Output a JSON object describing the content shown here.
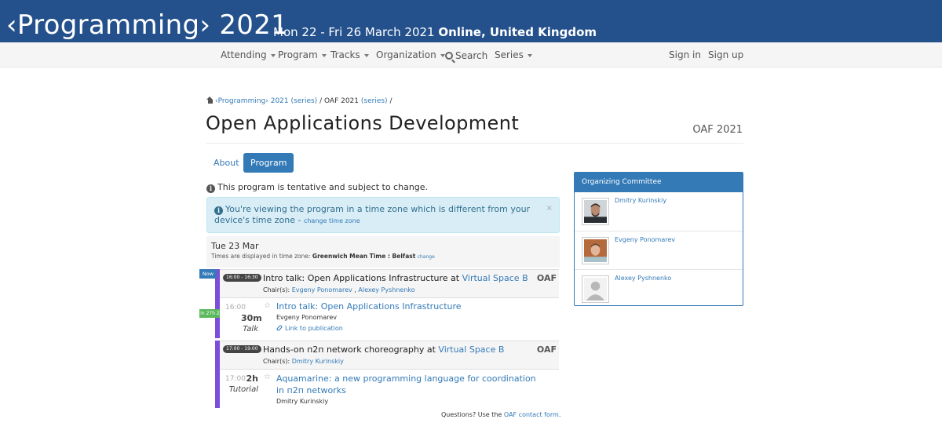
{
  "banner": {
    "conference": "‹Programming› 2021",
    "dates": "Mon 22 - Fri 26 March 2021",
    "location": "Online, United Kingdom"
  },
  "nav": {
    "attending": "Attending",
    "program": "Program",
    "tracks": "Tracks",
    "organization": "Organization",
    "search": "Search",
    "series": "Series",
    "sign_in": "Sign in",
    "sign_up": "Sign up"
  },
  "breadcrumb": {
    "conf": "‹Programming› 2021",
    "series1": "(series)",
    "sep1": "/",
    "track": "OAF 2021",
    "series2": "(series)",
    "sep2": "/"
  },
  "page": {
    "title": "Open Applications Development",
    "subtitle": "OAF 2021"
  },
  "tabs": {
    "about": "About",
    "program": "Program"
  },
  "notices": {
    "tentative": "This program is tentative and subject to change.",
    "tz_message": "You're viewing the program in a time zone which is different from your device's time zone -",
    "tz_change": "change time zone",
    "close": "×"
  },
  "day": {
    "date": "Tue 23 Mar",
    "tz_prefix": "Times are displayed in time zone:",
    "tz_name": "Greenwich Mean Time : Belfast",
    "tz_change": "change"
  },
  "badges": {
    "now": "Now",
    "in": "in 27h 21 min"
  },
  "sessions": [
    {
      "time": "16:00 - 16:30",
      "title_prefix": "Intro talk: Open Applications Infrastructure at",
      "room": "Virtual Space B",
      "chairs_label": "Chair(s):",
      "chair1": "Evgeny Ponomarev",
      "chair_sep": ",",
      "chair2": "Alexey Pyshnenko",
      "track": "OAF",
      "event": {
        "start": "16:00",
        "duration": "30m",
        "type": "Talk",
        "title": "Intro talk: Open Applications Infrastructure",
        "author": "Evgeny Ponomarev",
        "link": "Link to publication"
      }
    },
    {
      "time": "17:00 - 19:00",
      "title_prefix": "Hands-on п2п network choreography at",
      "room": "Virtual Space B",
      "chairs_label": "Chair(s):",
      "chair1": "Dmitry Kurinskiy",
      "track": "OAF",
      "event": {
        "start": "17:00",
        "duration": "2h",
        "type": "Tutorial",
        "title": "Aquamarine: a new programming language for coordination in п2п networks",
        "author": "Dmitry Kurinskiy"
      }
    }
  ],
  "footer": {
    "questions_prefix": "Questions? Use the",
    "contact_link": "OAF contact form",
    "questions_suffix": "."
  },
  "committee": {
    "heading": "Organizing Committee",
    "members": [
      {
        "name": "Dmitry Kurinskiy"
      },
      {
        "name": "Evgeny Ponomarev"
      },
      {
        "name": "Alexey Pyshnenko"
      }
    ]
  },
  "colors": {
    "banner": "#24518c",
    "primary": "#337ab7",
    "session_bar": "#7c4dd8",
    "in_badge": "#5cb85c"
  }
}
